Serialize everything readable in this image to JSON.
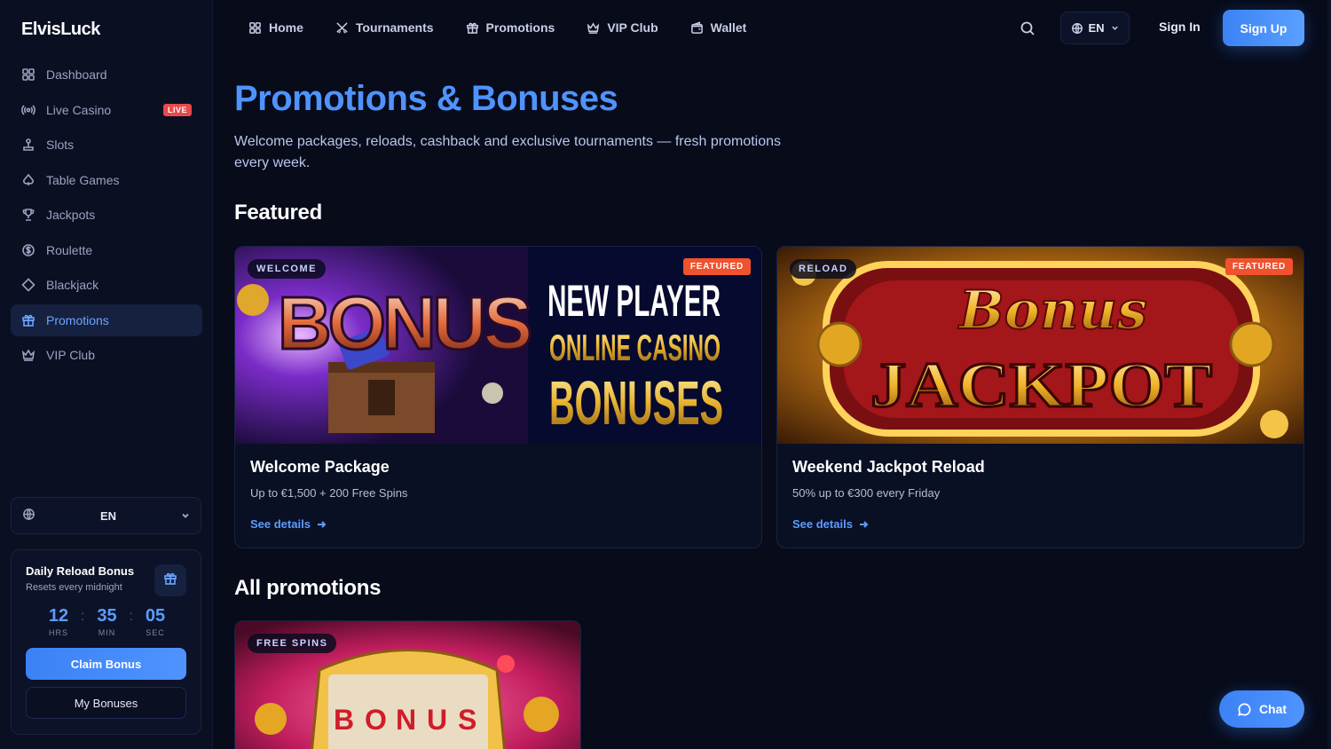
{
  "brand": {
    "name": "ElvisLuck",
    "accent": "#4f93ff",
    "live_color": "#e84a4a",
    "featured_color": "#f0522e"
  },
  "sidebar": {
    "items": [
      {
        "label": "Dashboard",
        "icon": "grid-icon"
      },
      {
        "label": "Live Casino",
        "icon": "broadcast-icon",
        "badge": "LIVE"
      },
      {
        "label": "Slots",
        "icon": "joystick-icon"
      },
      {
        "label": "Table Games",
        "icon": "spade-icon"
      },
      {
        "label": "Jackpots",
        "icon": "trophy-icon"
      },
      {
        "label": "Roulette",
        "icon": "dollar-icon"
      },
      {
        "label": "Blackjack",
        "icon": "diamond-icon"
      },
      {
        "label": "Promotions",
        "icon": "gift-icon",
        "active": true
      },
      {
        "label": "VIP Club",
        "icon": "crown-icon"
      }
    ],
    "language": "EN",
    "bonus": {
      "title": "Daily Reload Bonus",
      "subtitle": "Resets every midnight",
      "hours": "12",
      "hours_label": "HRS",
      "minutes": "35",
      "minutes_label": "MIN",
      "seconds": "05",
      "seconds_label": "SEC",
      "claim_label": "Claim Bonus",
      "my_bonuses_label": "My Bonuses"
    }
  },
  "topnav": {
    "links": [
      {
        "label": "Home",
        "icon": "grid-icon"
      },
      {
        "label": "Tournaments",
        "icon": "swords-icon"
      },
      {
        "label": "Promotions",
        "icon": "gift-icon"
      },
      {
        "label": "VIP Club",
        "icon": "crown-icon"
      },
      {
        "label": "Wallet",
        "icon": "wallet-icon"
      }
    ],
    "language": "EN",
    "sign_in": "Sign In",
    "sign_up": "Sign Up"
  },
  "main": {
    "title": "Promotions & Bonuses",
    "description": "Welcome packages, reloads, cashback and exclusive tournaments — fresh promotions every week.",
    "featured_heading": "Featured",
    "all_heading": "All promotions",
    "featured_cards": [
      {
        "tag": "WELCOME",
        "badge": "FEATURED",
        "banner_left_text": "BONUS",
        "banner_lines": [
          "NEW PLAYER",
          "ONLINE CASINO",
          "BONUSES"
        ],
        "title": "Welcome Package",
        "subtitle": "Up to €1,500 + 200 Free Spins",
        "link": "See details"
      },
      {
        "tag": "RELOAD",
        "badge": "FEATURED",
        "banner_lines": [
          "Bonus",
          "JACKPOT"
        ],
        "title": "Weekend Jackpot Reload",
        "subtitle": "50% up to €300 every Friday",
        "link": "See details"
      }
    ],
    "all_cards": [
      {
        "tag": "FREE SPINS",
        "banner_letters": [
          "B",
          "O",
          "N",
          "U",
          "S"
        ]
      }
    ]
  },
  "chat": {
    "label": "Chat"
  }
}
